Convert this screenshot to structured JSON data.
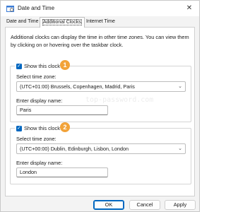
{
  "window": {
    "title": "Date and Time",
    "close_glyph": "✕"
  },
  "tabs": [
    {
      "label": "Date and Time",
      "active": false
    },
    {
      "label": "Additional Clocks",
      "active": true
    },
    {
      "label": "Internet Time",
      "active": false
    }
  ],
  "intro_text": "Additional clocks can display the time in other time zones. You can view them by clicking on or hovering over the taskbar clock.",
  "clocks": [
    {
      "show_label": "Show this clock",
      "checked": true,
      "badge": "1",
      "timezone_label": "Select time zone:",
      "timezone_value": "(UTC+01:00) Brussels, Copenhagen, Madrid, Paris",
      "display_name_label": "Enter display name:",
      "display_name_value": "Paris"
    },
    {
      "show_label": "Show this clock",
      "checked": true,
      "badge": "2",
      "timezone_label": "Select time zone:",
      "timezone_value": "(UTC+00:00) Dublin, Edinburgh, Lisbon, London",
      "display_name_label": "Enter display name:",
      "display_name_value": "London"
    }
  ],
  "watermark": "top-password.com",
  "buttons": {
    "ok": "OK",
    "cancel": "Cancel",
    "apply": "Apply"
  },
  "colors": {
    "accent": "#0067c0",
    "badge": "#f2a33a"
  }
}
